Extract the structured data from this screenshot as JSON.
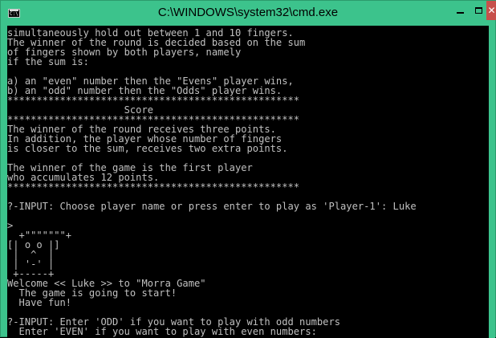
{
  "window": {
    "title": "C:\\WINDOWS\\system32\\cmd.exe"
  },
  "console": {
    "lines": [
      "simultaneously hold out between 1 and 10 fingers.",
      "The winner of the round is decided based on the sum",
      "of fingers shown by both players, namely",
      "if the sum is:",
      "",
      "a) an \"even\" number then the \"Evens\" player wins,",
      "b) an \"odd\" number then the \"Odds\" player wins.",
      "**************************************************",
      "                    Score",
      "**************************************************",
      "The winner of the round receives three points.",
      "In addition, the player whose number of fingers",
      "is closer to the sum, receives two extra points.",
      "",
      "The winner of the game is the first player",
      "who accumulates 12 points.",
      "**************************************************",
      "",
      "?-INPUT: Choose player name or press enter to play as 'Player-1': Luke",
      "",
      ">",
      "  +\"\"\"\"\"\"\"+",
      "[| o o |]",
      " |  ^  |",
      " | '-' |",
      " +-----+",
      "Welcome << Luke >> to \"Morra Game\"",
      "  The game is going to start!",
      "  Have fun!",
      "",
      "?-INPUT: Enter 'ODD' if you want to play with odd numbers",
      "  Enter 'EVEN' if you want to play with even numbers:"
    ]
  }
}
